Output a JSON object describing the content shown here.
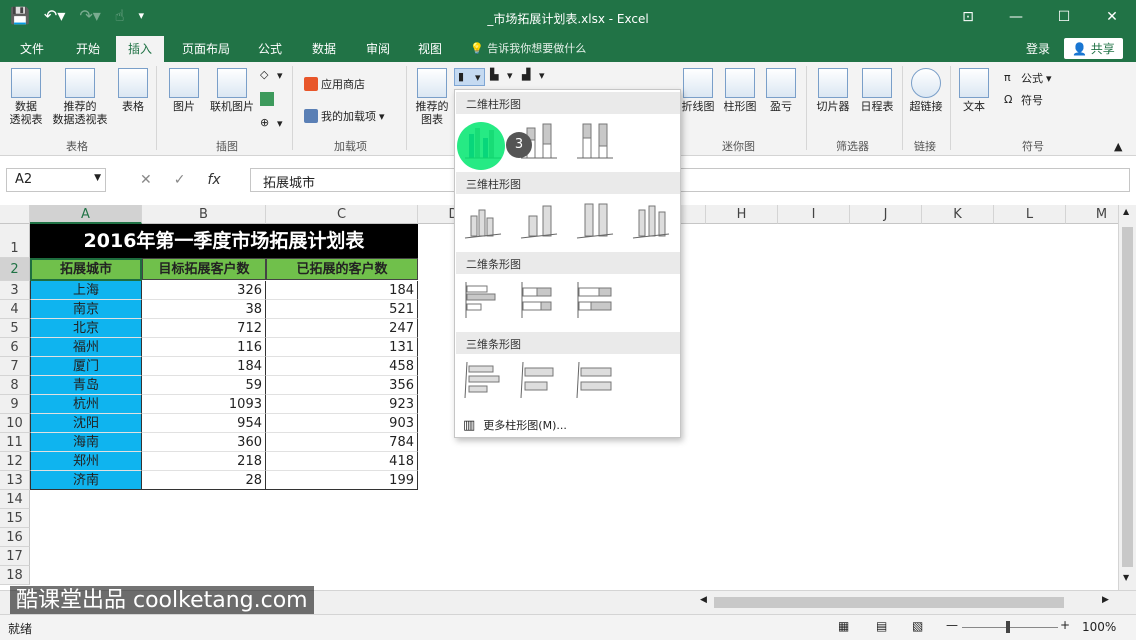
{
  "window": {
    "title": "_市场拓展计划表.xlsx - Excel"
  },
  "tabs": [
    "文件",
    "开始",
    "插入",
    "页面布局",
    "公式",
    "数据",
    "审阅",
    "视图"
  ],
  "active_tab": "插入",
  "tell_me": "告诉我你想要做什么",
  "login": "登录",
  "share": "共享",
  "ribbon": {
    "pivot": "数据\n透视表",
    "rec_pivot": "推荐的\n数据透视表",
    "table": "表格",
    "group_table": "表格",
    "picture": "图片",
    "online_pic": "联机图片",
    "group_illus": "插图",
    "store": "应用商店",
    "myaddins": "我的加载项",
    "group_addins": "加载项",
    "rec_chart": "推荐的\n图表",
    "line": "折线图",
    "column": "柱形图",
    "winloss": "盈亏",
    "group_spark": "迷你图",
    "slicer": "切片器",
    "timeline": "日程表",
    "group_filter": "筛选器",
    "hyperlink": "超链接",
    "group_link": "链接",
    "text": "文本",
    "formula": "公式",
    "symbol": "符号",
    "group_symbol": "符号"
  },
  "namebox": "A2",
  "formula_bar": "拓展城市",
  "columns": [
    "A",
    "B",
    "C",
    "D",
    "E",
    "F",
    "G",
    "H",
    "I",
    "J",
    "K",
    "L",
    "M"
  ],
  "sheet": {
    "title": "2016年第一季度市场拓展计划表",
    "headers": [
      "拓展城市",
      "目标拓展客户数",
      "已拓展的客户数"
    ],
    "rows": [
      [
        "上海",
        "326",
        "184"
      ],
      [
        "南京",
        "38",
        "521"
      ],
      [
        "北京",
        "712",
        "247"
      ],
      [
        "福州",
        "116",
        "131"
      ],
      [
        "厦门",
        "184",
        "458"
      ],
      [
        "青岛",
        "59",
        "356"
      ],
      [
        "杭州",
        "1093",
        "923"
      ],
      [
        "沈阳",
        "954",
        "903"
      ],
      [
        "海南",
        "360",
        "784"
      ],
      [
        "郑州",
        "218",
        "418"
      ],
      [
        "济南",
        "28",
        "199"
      ]
    ]
  },
  "row_numbers": [
    "1",
    "2",
    "3",
    "4",
    "5",
    "6",
    "7",
    "8",
    "9",
    "10",
    "11",
    "12",
    "13",
    "14",
    "15",
    "16",
    "17",
    "18"
  ],
  "dropdown": {
    "sec1": "二维柱形图",
    "sec2": "三维柱形图",
    "sec3": "二维条形图",
    "sec4": "三维条形图",
    "more": "更多柱形图(M)..."
  },
  "badge": "3",
  "watermark": "酷课堂出品 coolketang.com",
  "status": {
    "ready": "就绪",
    "zoom": "100%"
  }
}
